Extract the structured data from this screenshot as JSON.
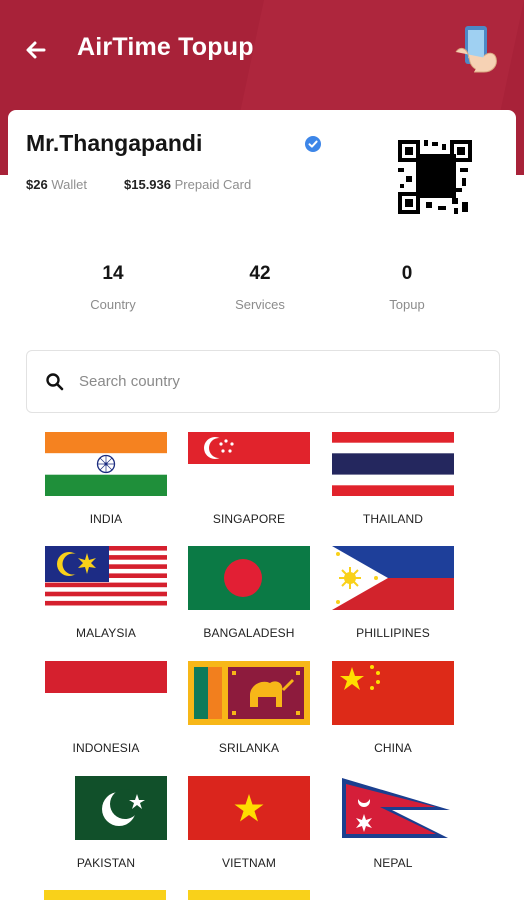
{
  "header": {
    "title": "AirTime Topup"
  },
  "user": {
    "name": "Mr.Thangapandi",
    "wallet_amount": "$26",
    "wallet_label": "Wallet",
    "prepaid_amount": "$15.936",
    "prepaid_label": "Prepaid Card"
  },
  "stats": [
    {
      "value": "14",
      "label": "Country"
    },
    {
      "value": "42",
      "label": "Services"
    },
    {
      "value": "0",
      "label": "Topup"
    }
  ],
  "search": {
    "placeholder": "Search country"
  },
  "countries": [
    {
      "name": "INDIA"
    },
    {
      "name": "SINGAPORE"
    },
    {
      "name": "THAILAND"
    },
    {
      "name": "MALAYSIA"
    },
    {
      "name": "BANGALADESH"
    },
    {
      "name": "PHILLIPINES"
    },
    {
      "name": "INDONESIA"
    },
    {
      "name": "SRILANKA"
    },
    {
      "name": "CHINA"
    },
    {
      "name": "PAKISTAN"
    },
    {
      "name": "VIETNAM"
    },
    {
      "name": "NEPAL"
    }
  ],
  "colors": {
    "header": "#a82239",
    "verified": "#3d86e8"
  }
}
